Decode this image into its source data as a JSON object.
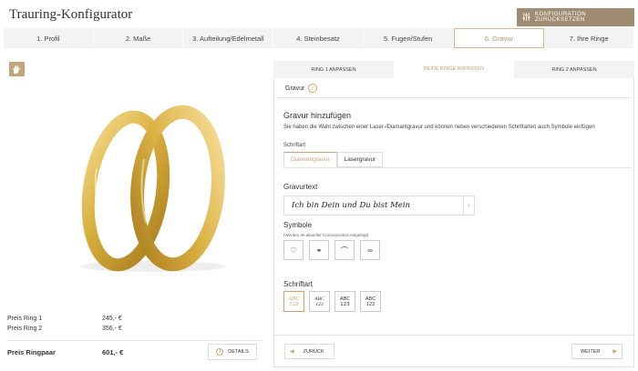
{
  "header": {
    "title": "Trauring-Konfigurator",
    "reset_label": "KONFIGURATION ZURÜCKSETZEN",
    "reset_icon": "sliders-icon"
  },
  "steps": [
    {
      "label": "1. Profil"
    },
    {
      "label": "2. Maße"
    },
    {
      "label": "3. Aufteilung/Edelmetall"
    },
    {
      "label": "4. Steinbesatz"
    },
    {
      "label": "5. Fugen/Stufen"
    },
    {
      "label": "6. Gravur",
      "active": true
    },
    {
      "label": "7. Ihre Ringe"
    }
  ],
  "preview": {
    "hand_icon": "hand-icon",
    "prices": [
      {
        "label": "Preis Ring 1",
        "value": "245,- €"
      },
      {
        "label": "Preis Ring 2",
        "value": "356,- €"
      }
    ],
    "total_label": "Preis Ringpaar",
    "total_value": "601,- €",
    "details_label": "DETAILS"
  },
  "ring_tabs": [
    {
      "label": "RING 1 ANPASSEN"
    },
    {
      "label": "BEIDE RINGE ANPASSEN",
      "active": true
    },
    {
      "label": "RING 2 ANPASSEN"
    }
  ],
  "gravur": {
    "sub_label": "Gravur",
    "section_title": "Gravur hinzufügen",
    "description": "Sie haben die Wahl zwischen einer Laser-/Diamantgravur und können neben verschiedenen Schriftarten auch Symbole einfügen",
    "schriftart_label": "Schriftart",
    "engraving_types": [
      {
        "label": "Diamantgravur",
        "active": true
      },
      {
        "label": "Lasergravur"
      }
    ],
    "text_label": "Gravurtext",
    "text_value": "Ich bin Dein und Du bist Mein",
    "symbole_label": "Symbole",
    "symbole_note": "(Werden an aktueller Cursorposition eingefügt)",
    "symbols": [
      "♡",
      "⚭",
      "⌒",
      "∞"
    ],
    "font_title": "Schriftart",
    "fonts": [
      {
        "top": "ABC",
        "bottom": "123",
        "active": true
      },
      {
        "top": "ABC",
        "bottom": "123"
      },
      {
        "top": "ABC",
        "bottom": "123"
      },
      {
        "top": "ABC",
        "bottom": "123"
      }
    ]
  },
  "nav": {
    "back_label": "ZURÜCK",
    "next_label": "WEITER"
  },
  "colors": {
    "accent": "#c4a479",
    "accent_dark": "#a08c73",
    "gold_ring": "#d7ae3e"
  }
}
